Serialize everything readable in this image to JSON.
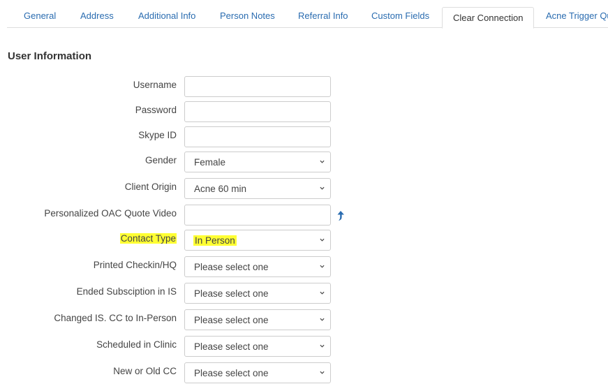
{
  "tabs": [
    {
      "label": "General"
    },
    {
      "label": "Address"
    },
    {
      "label": "Additional Info"
    },
    {
      "label": "Person Notes"
    },
    {
      "label": "Referral Info"
    },
    {
      "label": "Custom Fields"
    },
    {
      "label": "Clear Connection"
    },
    {
      "label": "Acne Trigger Qu"
    }
  ],
  "active_tab": "Clear Connection",
  "section": {
    "title": "User Information"
  },
  "fields": {
    "username": {
      "label": "Username",
      "value": ""
    },
    "password": {
      "label": "Password",
      "value": ""
    },
    "skype": {
      "label": "Skype ID",
      "value": ""
    },
    "gender": {
      "label": "Gender",
      "value": "Female"
    },
    "client_origin": {
      "label": "Client Origin",
      "value": "Acne 60 min"
    },
    "video": {
      "label": "Personalized OAC Quote Video",
      "value": ""
    },
    "contact_type": {
      "label": "Contact Type",
      "value": "In Person"
    },
    "printed_checkin": {
      "label": "Printed Checkin/HQ",
      "value": "Please select one"
    },
    "ended_subscription": {
      "label": "Ended Subsciption in IS",
      "value": "Please select one"
    },
    "changed_is": {
      "label": "Changed IS. CC to In-Person",
      "value": "Please select one"
    },
    "scheduled_clinic": {
      "label": "Scheduled in Clinic",
      "value": "Please select one"
    },
    "new_old_cc": {
      "label": "New or Old CC",
      "value": "Please select one"
    }
  },
  "colors": {
    "link": "#2a6cb0",
    "highlight": "#ffff33",
    "upload_icon": "#2a6cb0"
  },
  "icons": {
    "select_arrow": "chevron-down-icon",
    "upload": "upload-arrow-icon"
  }
}
